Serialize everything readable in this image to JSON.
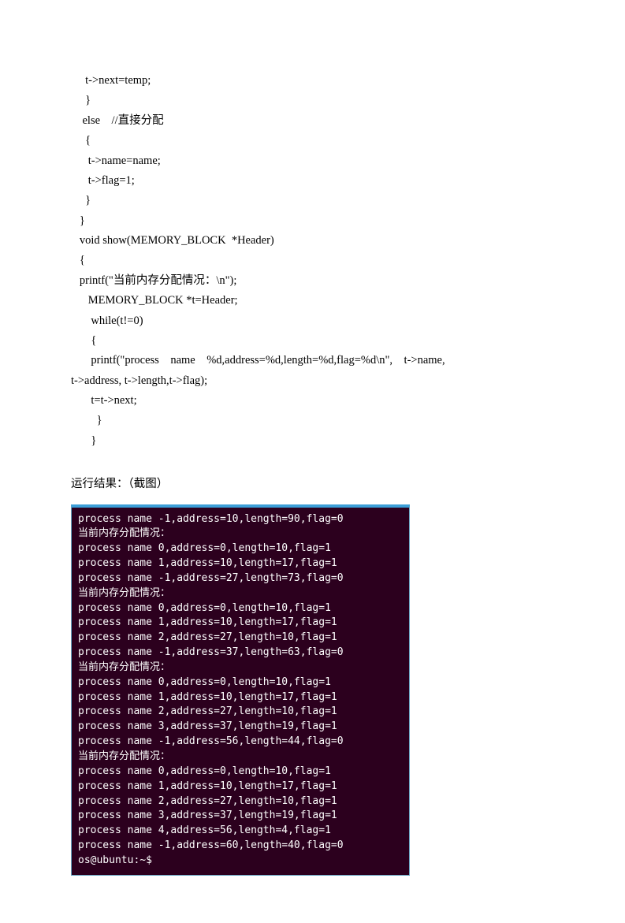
{
  "code": {
    "lines": [
      "     t->next=temp;",
      "     }",
      "    else    //直接分配",
      "     {",
      "      t->name=name;",
      "      t->flag=1;",
      "     }",
      "   }",
      "   void show(MEMORY_BLOCK  *Header)",
      "   {",
      "   printf(\"当前内存分配情况：\\n\");",
      "      MEMORY_BLOCK *t=Header;",
      "       while(t!=0)",
      "       {",
      "       printf(\"process    name    %d,address=%d,length=%d,flag=%d\\n\",    t->name,",
      "t->address, t->length,t->flag);",
      "       t=t->next;",
      "         }",
      "       }"
    ]
  },
  "heading": "运行结果：（截图）",
  "terminal": {
    "lines": [
      "process name -1,address=10,length=90,flag=0",
      "当前内存分配情况：",
      "process name 0,address=0,length=10,flag=1",
      "process name 1,address=10,length=17,flag=1",
      "process name -1,address=27,length=73,flag=0",
      "当前内存分配情况：",
      "process name 0,address=0,length=10,flag=1",
      "process name 1,address=10,length=17,flag=1",
      "process name 2,address=27,length=10,flag=1",
      "process name -1,address=37,length=63,flag=0",
      "当前内存分配情况：",
      "process name 0,address=0,length=10,flag=1",
      "process name 1,address=10,length=17,flag=1",
      "process name 2,address=27,length=10,flag=1",
      "process name 3,address=37,length=19,flag=1",
      "process name -1,address=56,length=44,flag=0",
      "当前内存分配情况：",
      "process name 0,address=0,length=10,flag=1",
      "process name 1,address=10,length=17,flag=1",
      "process name 2,address=27,length=10,flag=1",
      "process name 3,address=37,length=19,flag=1",
      "process name 4,address=56,length=4,flag=1",
      "process name -1,address=60,length=40,flag=0",
      "os@ubuntu:~$"
    ]
  }
}
